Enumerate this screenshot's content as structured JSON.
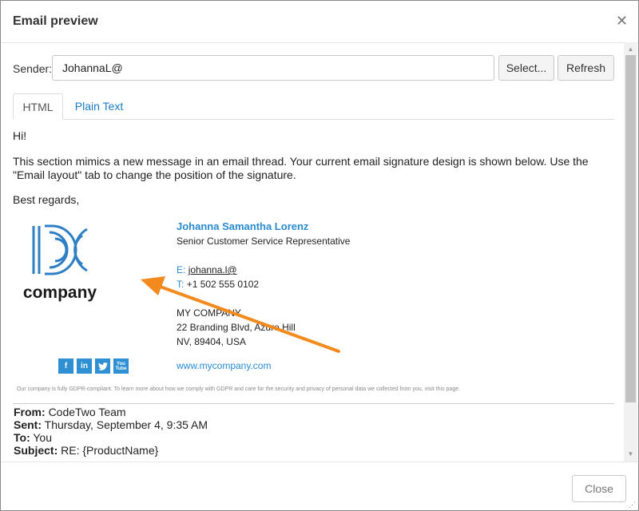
{
  "dialog": {
    "title": "Email preview"
  },
  "sender": {
    "label": "Sender:",
    "value": "JohannaL@"
  },
  "buttons": {
    "select": "Select...",
    "refresh": "Refresh",
    "close": "Close"
  },
  "tabs": [
    {
      "label": "HTML",
      "active": true
    },
    {
      "label": "Plain Text",
      "active": false
    }
  ],
  "message": {
    "greeting": "Hi!",
    "body": "This section mimics a new message in an email thread. Your current email signature design is shown below. Use the \"Email layout\" tab to change the position of the signature.",
    "closing": "Best regards,"
  },
  "signature": {
    "logo_text": "company",
    "name": "Johanna Samantha Lorenz",
    "title": "Senior Customer Service Representative",
    "email_label": "E:",
    "email": "johanna.l@",
    "phone_label": "T:",
    "phone": "+1 502 555 0102",
    "company": "MY COMPANY",
    "address1": "22 Branding Blvd, Azure Hill",
    "address2": "NV, 89404, USA",
    "website": "www.mycompany.com",
    "social": [
      "f",
      "in",
      "t",
      "You Tube"
    ],
    "gdpr": "Our company is fully GDPR-compliant. To learn more about how we comply with GDPR and care for the security and privacy of personal data we collected from you, visit this page."
  },
  "thread": {
    "from_label": "From:",
    "from": "CodeTwo Team",
    "sent_label": "Sent:",
    "sent": "Thursday, September 4, 9:35 AM",
    "to_label": "To:",
    "to": "You",
    "subject_label": "Subject:",
    "subject": "RE: {ProductName}"
  },
  "colors": {
    "accent": "#2a8bd0",
    "arrow": "#f28a1e",
    "logo": "#2f7fc4"
  },
  "icons": {
    "close": "close-icon",
    "resize": "resize-grip-icon"
  }
}
